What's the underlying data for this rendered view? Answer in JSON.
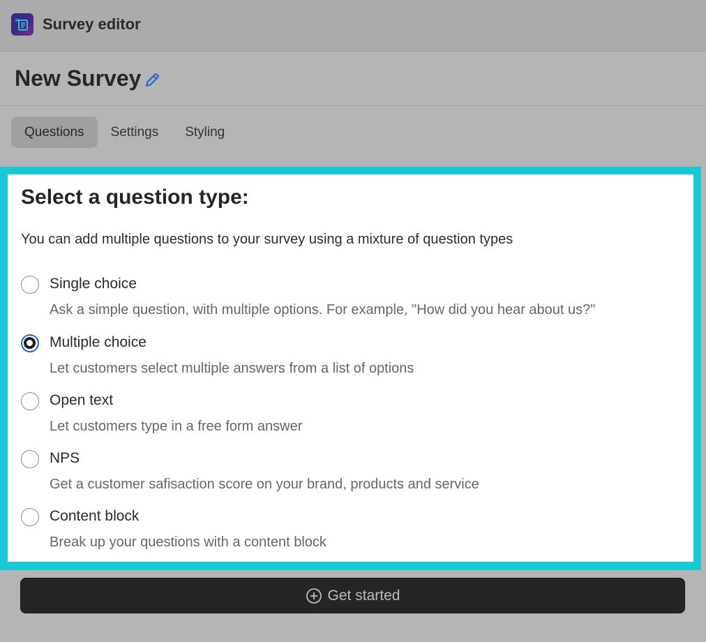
{
  "app": {
    "title": "Survey editor"
  },
  "survey": {
    "name": "New Survey"
  },
  "tabs": [
    {
      "label": "Questions",
      "active": true
    },
    {
      "label": "Settings",
      "active": false
    },
    {
      "label": "Styling",
      "active": false
    }
  ],
  "panel": {
    "heading": "Select a question type:",
    "subtext": "You can add multiple questions to your survey using a mixture of question types",
    "options": [
      {
        "label": "Single choice",
        "description": "Ask a simple question, with multiple options. For example, \"How did you hear about us?\"",
        "selected": false
      },
      {
        "label": "Multiple choice",
        "description": "Let customers select multiple answers from a list of options",
        "selected": true
      },
      {
        "label": "Open text",
        "description": "Let customers type in a free form answer",
        "selected": false
      },
      {
        "label": "NPS",
        "description": "Get a customer safisaction score on your brand, products and service",
        "selected": false
      },
      {
        "label": "Content block",
        "description": "Break up your questions with a content block",
        "selected": false
      }
    ]
  },
  "cta": {
    "label": "Get started",
    "icon": "plus-circle-icon"
  },
  "colors": {
    "highlight": "#16c9d4",
    "radio_focus": "#2a62d6",
    "edit_icon": "#2a62d6",
    "button_bg": "#252525"
  }
}
